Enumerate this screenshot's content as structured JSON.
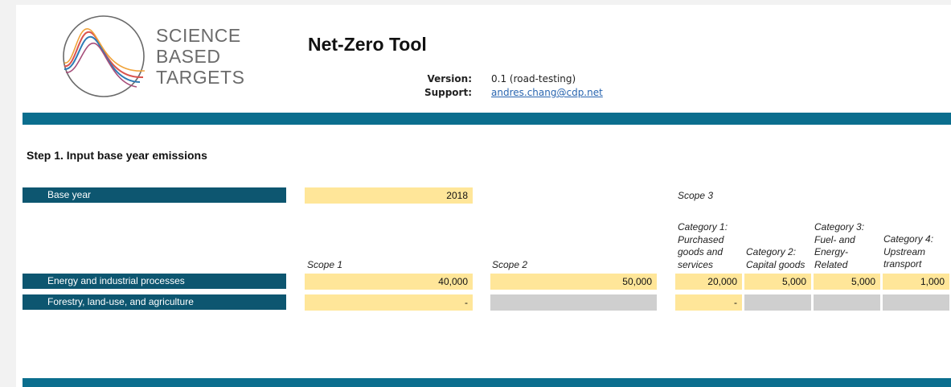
{
  "logo": {
    "line1": "SCIENCE",
    "line2": "BASED",
    "line3": "TARGETS"
  },
  "header": {
    "title": "Net-Zero Tool",
    "version_label": "Version:",
    "version_value": "0.1 (road-testing)",
    "support_label": "Support:",
    "support_email": "andres.chang@cdp.net"
  },
  "colors": {
    "band": "#0b6e8e",
    "row_header": "#0d5670",
    "input_cell": "#ffe699",
    "disabled_cell": "#cfcfcf"
  },
  "step1": {
    "title": "Step 1. Input base year emissions",
    "base_year_label": "Base year",
    "base_year_value": "2018",
    "scope3_label": "Scope 3",
    "columns": {
      "scope1": "Scope 1",
      "scope2": "Scope 2",
      "cat1": [
        "Category 1:",
        "Purchased",
        "goods and",
        "services"
      ],
      "cat2": [
        "Category 2:",
        "Capital goods"
      ],
      "cat3": [
        "Category 3:",
        "Fuel- and",
        "Energy-",
        "Related"
      ],
      "cat4": [
        "Category 4:",
        "Upstream",
        "transport"
      ]
    },
    "rows": [
      {
        "label": "Energy and industrial processes",
        "scope1": "40,000",
        "scope2": "50,000",
        "cat1": "20,000",
        "cat2": "5,000",
        "cat3": "5,000",
        "cat4": "1,000"
      },
      {
        "label": "Forestry, land-use, and agriculture",
        "scope1": "-",
        "scope2": "",
        "cat1": "-",
        "cat2": "",
        "cat3": "",
        "cat4": ""
      }
    ]
  }
}
